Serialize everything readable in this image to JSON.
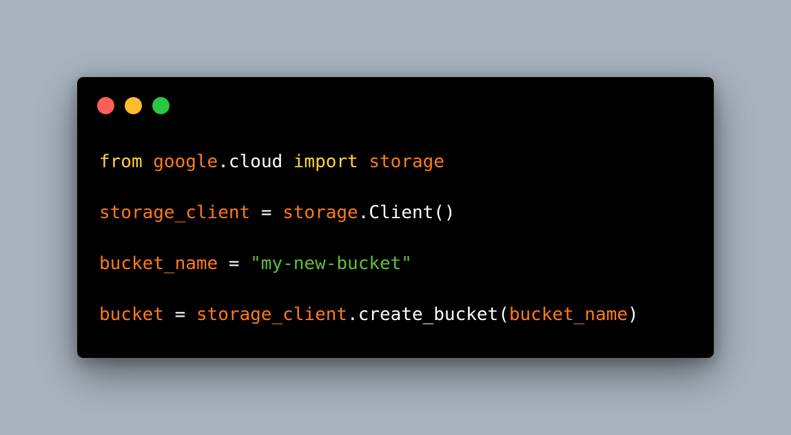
{
  "window": {
    "buttons": {
      "close_color": "#ff5f57",
      "minimize_color": "#febc2e",
      "maximize_color": "#28c840"
    }
  },
  "colors": {
    "background": "#a8b3bf",
    "editor_background": "#000000",
    "keyword": "#ffd23f",
    "identifier": "#ff7a1a",
    "plain": "#ffffff",
    "string": "#5fbf3a"
  },
  "code": {
    "lines": [
      [
        {
          "text": "from",
          "kind": "keyword"
        },
        {
          "text": " ",
          "kind": "plain"
        },
        {
          "text": "google",
          "kind": "ident"
        },
        {
          "text": ".cloud ",
          "kind": "plain"
        },
        {
          "text": "import",
          "kind": "keyword"
        },
        {
          "text": " ",
          "kind": "plain"
        },
        {
          "text": "storage",
          "kind": "ident"
        }
      ],
      [
        {
          "text": "storage_client",
          "kind": "ident"
        },
        {
          "text": " = ",
          "kind": "plain"
        },
        {
          "text": "storage",
          "kind": "ident"
        },
        {
          "text": ".Client()",
          "kind": "plain"
        }
      ],
      [
        {
          "text": "bucket_name",
          "kind": "ident"
        },
        {
          "text": " = ",
          "kind": "plain"
        },
        {
          "text": "\"my-new-bucket\"",
          "kind": "string"
        }
      ],
      [
        {
          "text": "bucket",
          "kind": "ident"
        },
        {
          "text": " = ",
          "kind": "plain"
        },
        {
          "text": "storage_client",
          "kind": "ident"
        },
        {
          "text": ".create_bucket(",
          "kind": "plain"
        },
        {
          "text": "bucket_name",
          "kind": "ident"
        },
        {
          "text": ")",
          "kind": "plain"
        }
      ]
    ]
  }
}
